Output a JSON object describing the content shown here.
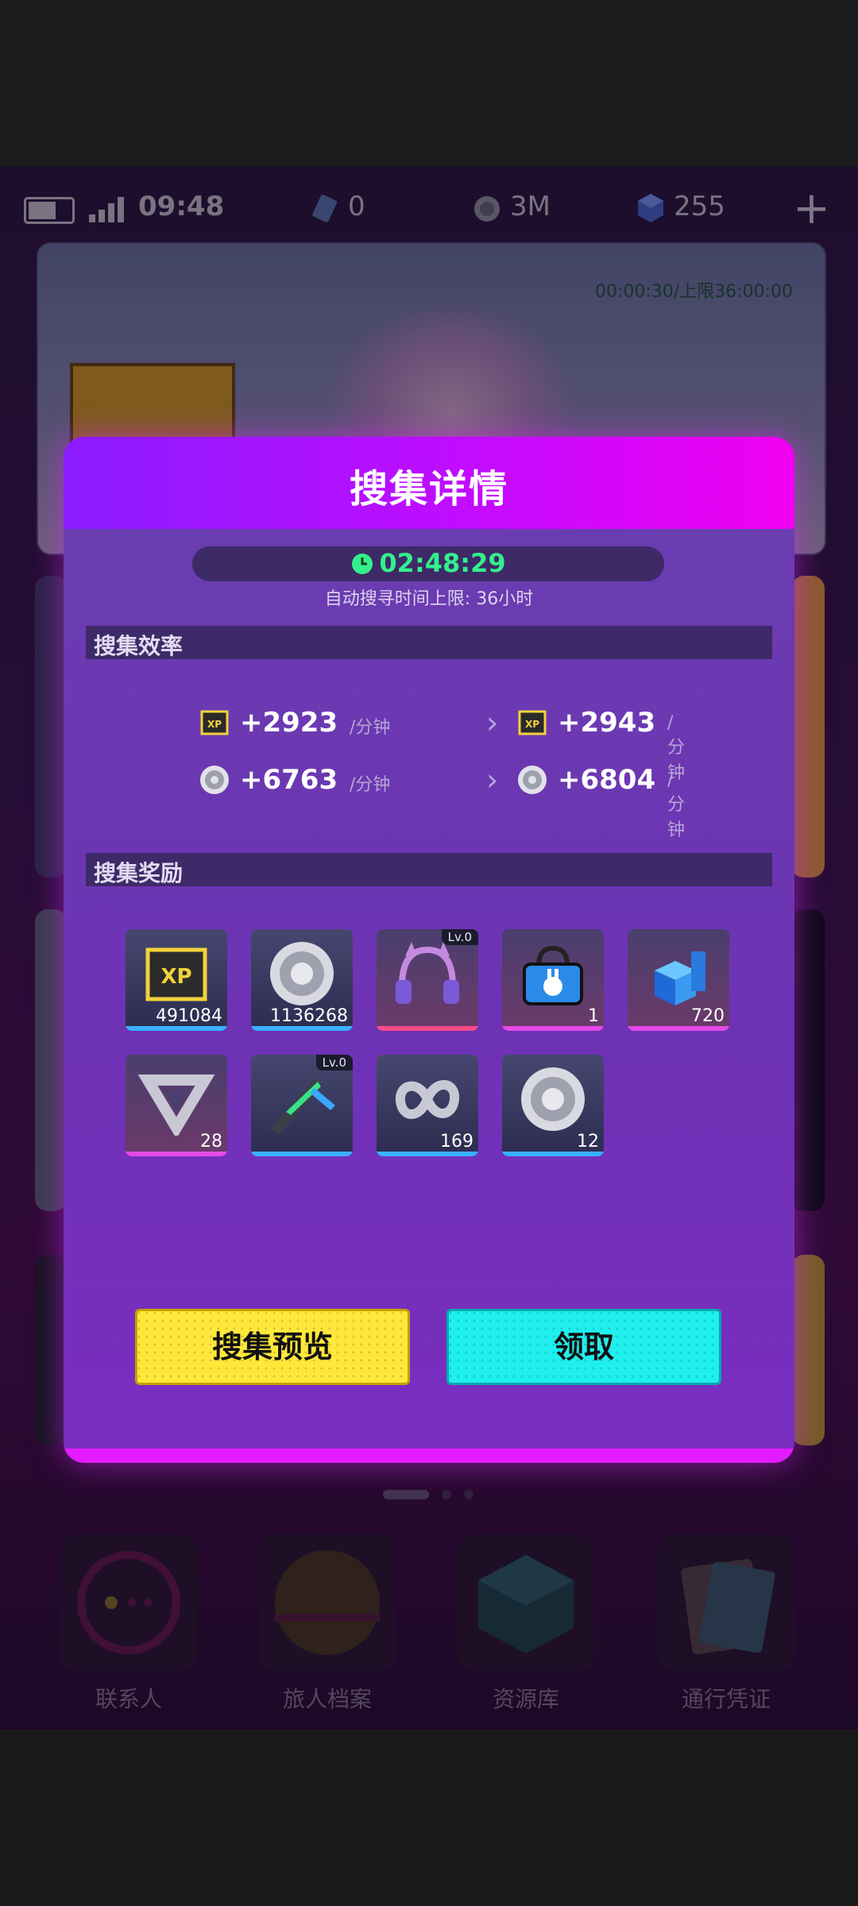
{
  "status_bar": {
    "time": "09:48",
    "currency_ticket": "0",
    "currency_coin": "3M",
    "currency_gem": "255"
  },
  "scene_timer": "00:00:30/上限36:00:00",
  "dock": [
    {
      "label": "联系人"
    },
    {
      "label": "旅人档案"
    },
    {
      "label": "资源库"
    },
    {
      "label": "通行凭证"
    }
  ],
  "modal": {
    "title": "搜集详情",
    "timer": "02:48:29",
    "timer_limit": "自动搜寻时间上限: 36小时",
    "efficiency": {
      "title": "搜集效率",
      "unit": "/分钟",
      "rows": [
        {
          "icon": "xp-chip-icon",
          "current": "+2923",
          "next": "+2943"
        },
        {
          "icon": "silver-coin-icon",
          "current": "+6763",
          "next": "+6804"
        }
      ]
    },
    "rewards": {
      "title": "搜集奖励",
      "items": [
        {
          "icon": "xp-chip-icon",
          "count": "491084",
          "badge": ""
        },
        {
          "icon": "silver-coin-icon",
          "count": "1136268",
          "badge": ""
        },
        {
          "icon": "cat-headphones-icon",
          "count": "",
          "badge": "Lv.0"
        },
        {
          "icon": "bunny-bag-icon",
          "count": "1",
          "badge": ""
        },
        {
          "icon": "blue-cube-icon",
          "count": "720",
          "badge": ""
        },
        {
          "icon": "impossible-triangle-icon",
          "count": "28",
          "badge": ""
        },
        {
          "icon": "dagger-icon",
          "count": "",
          "badge": "Lv.0"
        },
        {
          "icon": "infinity-icon",
          "count": "169",
          "badge": ""
        },
        {
          "icon": "silver-coin-icon",
          "count": "12",
          "badge": ""
        }
      ]
    },
    "preview_button": "搜集预览",
    "claim_button": "领取"
  },
  "colors": {
    "accent_green": "#32f08c",
    "header_gradient_start": "#8a1cff",
    "header_gradient_end": "#f000f0",
    "button_yellow": "#ffe83a",
    "button_cyan": "#1ff0ee"
  }
}
